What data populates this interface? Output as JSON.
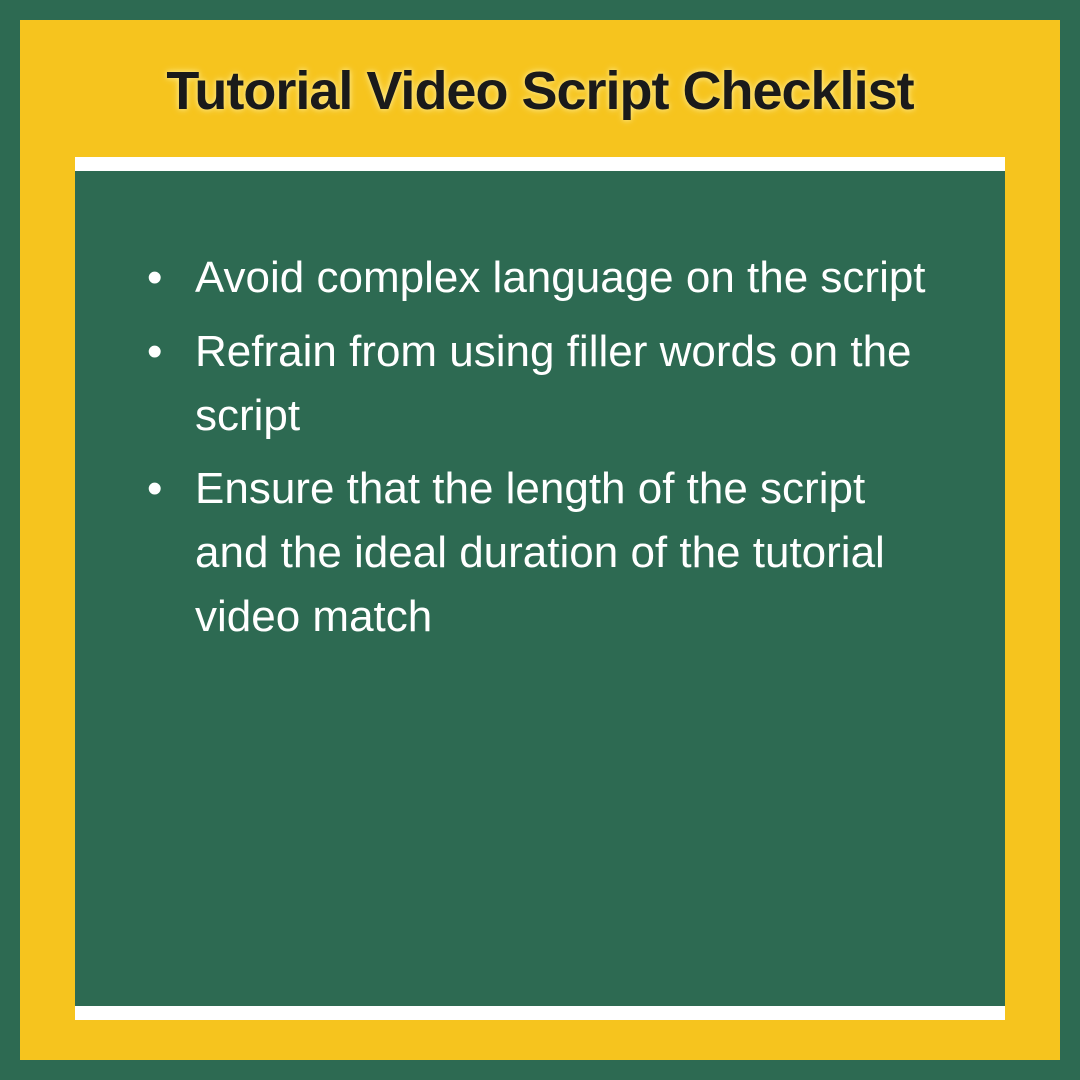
{
  "title": "Tutorial Video Script Checklist",
  "items": [
    "Avoid complex language on the script",
    "Refrain from using filler words on the script",
    "Ensure that the length of the script and the ideal duration of the tutorial video match"
  ]
}
